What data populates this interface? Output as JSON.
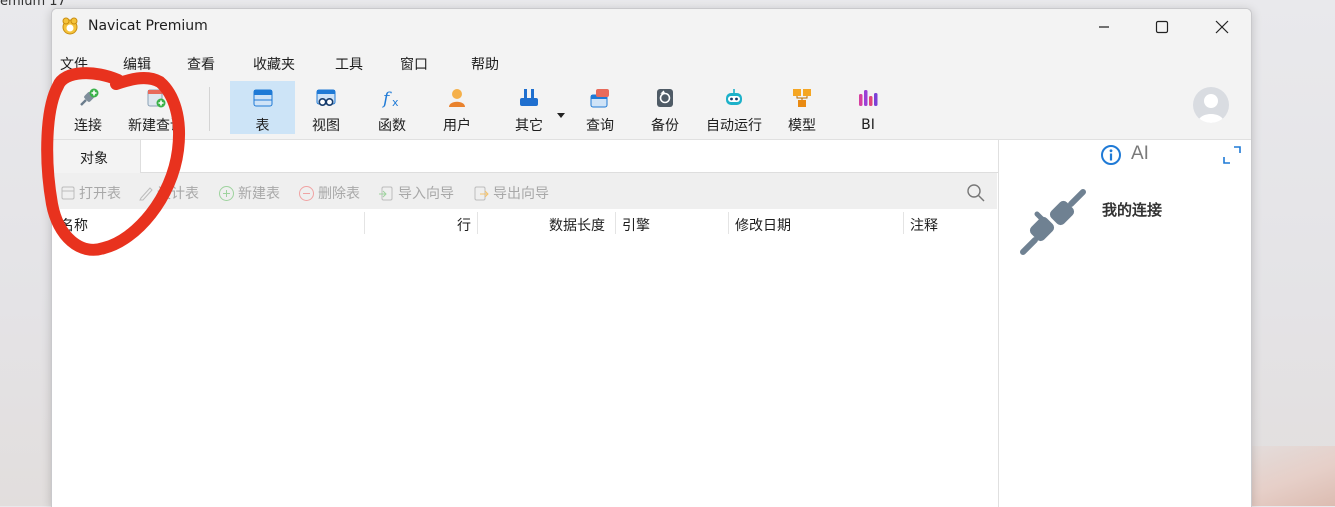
{
  "desktop": {
    "background_label": "emium 17"
  },
  "window": {
    "title": "Navicat Premium"
  },
  "menu": [
    "文件",
    "编辑",
    "查看",
    "收藏夹",
    "工具",
    "窗口",
    "帮助"
  ],
  "toolbar": {
    "connect": "连接",
    "new_query": "新建查询",
    "table": "表",
    "view": "视图",
    "function": "函数",
    "user": "用户",
    "other": "其它",
    "query": "查询",
    "backup": "备份",
    "automation": "自动运行",
    "model": "模型",
    "bi": "BI"
  },
  "objects_tab": "对象",
  "object_toolbar": {
    "open_table": "打开表",
    "design_table": "设计表",
    "new_table": "新建表",
    "delete_table": "删除表",
    "import_wizard": "导入向导",
    "export_wizard": "导出向导"
  },
  "columns": [
    "名称",
    "行",
    "数据长度",
    "引擎",
    "修改日期",
    "注释"
  ],
  "info_pane": {
    "ai_label": "AI",
    "title": "我的连接"
  },
  "colors": {
    "accent": "#0078d4",
    "active_tool_bg": "#cde4f7",
    "annotation": "#e8321e"
  }
}
